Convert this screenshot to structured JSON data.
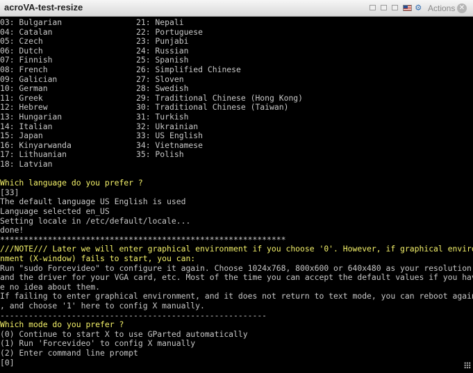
{
  "window": {
    "title": "acroVA-test-resize",
    "actions_label": "Actions",
    "icons": [
      "minimize-icon",
      "maximize-icon",
      "restore-icon",
      "flag-icon",
      "gear-icon",
      "close-icon"
    ]
  },
  "colors": {
    "terminal_bg": "#000000",
    "terminal_text": "#c8c8c8",
    "highlight_text": "#f5f26a"
  },
  "terminal": {
    "languages_left": [
      "03: Bulgarian",
      "04: Catalan",
      "05: Czech",
      "06: Dutch",
      "07: Finnish",
      "08: French",
      "09: Galician",
      "10: German",
      "11: Greek",
      "12: Hebrew",
      "13: Hungarian",
      "14: Italian",
      "15: Japan",
      "16: Kinyarwanda",
      "17: Lithuanian",
      "18: Latvian"
    ],
    "languages_right": [
      "21: Nepali",
      "22: Portuguese",
      "23: Punjabi",
      "24: Russian",
      "25: Spanish",
      "26: Simplified Chinese",
      "27: Sloven",
      "28: Swedish",
      "29: Traditional Chinese (Hong Kong)",
      "30: Traditional Chinese (Taiwan)",
      "31: Turkish",
      "32: Ukrainian",
      "33: US English",
      "34: Vietnamese",
      "35: Polish"
    ],
    "output": [
      {
        "text": "",
        "hl": false
      },
      {
        "text": "Which language do you prefer ?",
        "hl": true
      },
      {
        "text": "[33]",
        "hl": false
      },
      {
        "text": "The default language US English is used",
        "hl": false
      },
      {
        "text": "Language selected en_US",
        "hl": false
      },
      {
        "text": "Setting locale in /etc/default/locale...",
        "hl": false
      },
      {
        "text": "done!",
        "hl": false
      },
      {
        "text": "************************************************************",
        "hl": false
      },
      {
        "text": "///NOTE/// Later we will enter graphical environment if you choose '0'. However, if graphical enviro",
        "hl": true
      },
      {
        "text": "nment (X-window) fails to start, you can:",
        "hl": true
      },
      {
        "text": "Run \"sudo Forcevideo\" to configure it again. Choose 1024x768, 800x600 or 640x480 as your resolution",
        "hl": false
      },
      {
        "text": "and the driver for your VGA card, etc. Most of the time you can accept the default values if you hav",
        "hl": false
      },
      {
        "text": "e no idea about them.",
        "hl": false
      },
      {
        "text": "If failing to enter graphical environment, and it does not return to text mode, you can reboot again",
        "hl": false
      },
      {
        "text": ", and choose '1' here to config X manually.",
        "hl": false
      },
      {
        "text": "--------------------------------------------------------",
        "hl": false
      },
      {
        "text": "Which mode do you prefer ?",
        "hl": true
      },
      {
        "text": "(0) Continue to start X to use GParted automatically",
        "hl": false
      },
      {
        "text": "(1) Run 'Forcevideo' to config X manually",
        "hl": false
      },
      {
        "text": "(2) Enter command line prompt",
        "hl": false
      },
      {
        "text": "[0]",
        "hl": false
      }
    ]
  }
}
